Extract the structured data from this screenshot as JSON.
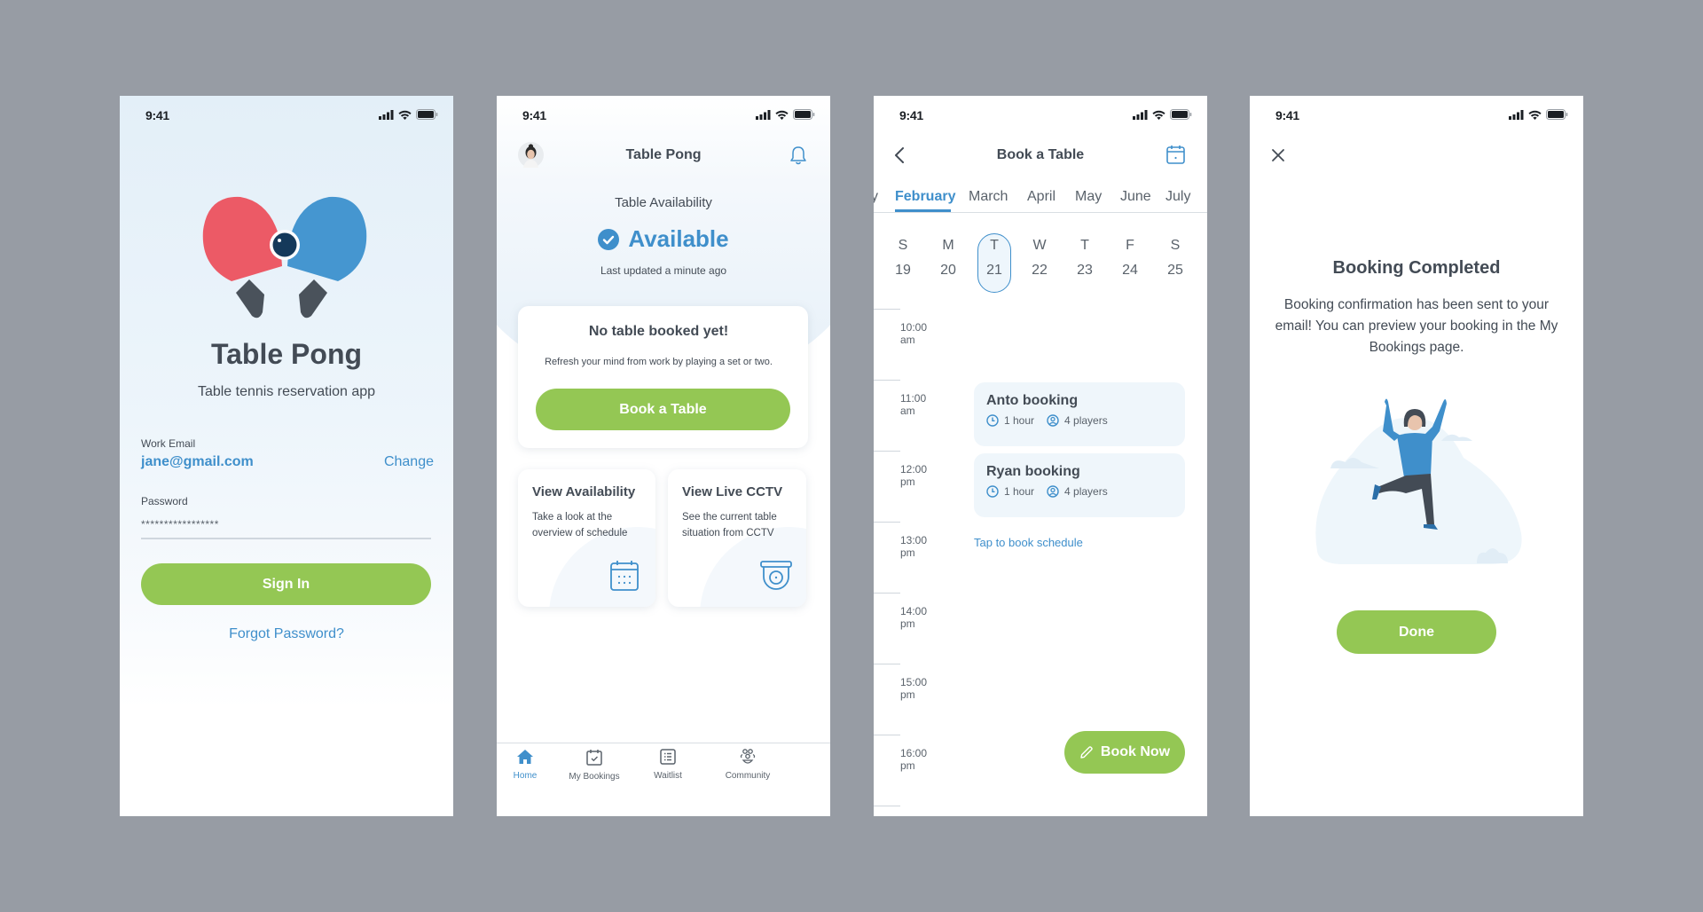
{
  "status_bar": {
    "time": "9:41"
  },
  "screens": {
    "login": {
      "app_title": "Table Pong",
      "subtitle": "Table tennis reservation app",
      "email_label": "Work Email",
      "email_value": "jane@gmail.com",
      "change_link": "Change",
      "password_label": "Password",
      "password_value": "*****************",
      "sign_in_button": "Sign In",
      "forgot_link": "Forgot Password?"
    },
    "home": {
      "header_title": "Table Pong",
      "availability_label": "Table Availability",
      "availability_status": "Available",
      "last_updated": "Last updated a minute ago",
      "empty_card": {
        "title": "No table booked yet!",
        "body": "Refresh your mind from work by playing a set or two.",
        "button": "Book a Table"
      },
      "cards": [
        {
          "title": "View Availability",
          "body_line1": "Take a look at the",
          "body_line2": "overview of schedule",
          "icon": "calendar-icon"
        },
        {
          "title": "View Live CCTV",
          "body_line1": "See the current table",
          "body_line2": "situation from CCTV",
          "icon": "cctv-camera-icon"
        }
      ],
      "nav": [
        {
          "label": "Home",
          "icon": "home-icon",
          "active": true
        },
        {
          "label": "My Bookings",
          "icon": "calendar-check-icon",
          "active": false
        },
        {
          "label": "Waitlist",
          "icon": "list-icon",
          "active": false
        },
        {
          "label": "Community",
          "icon": "community-icon",
          "active": false
        }
      ]
    },
    "book": {
      "header_title": "Book a Table",
      "months": [
        "y",
        "February",
        "March",
        "April",
        "May",
        "June",
        "July"
      ],
      "active_month": "February",
      "days": [
        {
          "dow": "S",
          "date": "19"
        },
        {
          "dow": "M",
          "date": "20"
        },
        {
          "dow": "T",
          "date": "21",
          "selected": true
        },
        {
          "dow": "W",
          "date": "22"
        },
        {
          "dow": "T",
          "date": "23"
        },
        {
          "dow": "F",
          "date": "24"
        },
        {
          "dow": "S",
          "date": "25"
        }
      ],
      "hours": [
        {
          "time": "10:00",
          "period": "am"
        },
        {
          "time": "11:00",
          "period": "am"
        },
        {
          "time": "12:00",
          "period": "pm"
        },
        {
          "time": "13:00",
          "period": "pm"
        },
        {
          "time": "14:00",
          "period": "pm"
        },
        {
          "time": "15:00",
          "period": "pm"
        },
        {
          "time": "16:00",
          "period": "pm"
        }
      ],
      "bookings": [
        {
          "title": "Anto booking",
          "duration": "1 hour",
          "players": "4 players"
        },
        {
          "title": "Ryan booking",
          "duration": "1 hour",
          "players": "4 players"
        }
      ],
      "tap_to_book": "Tap to book schedule",
      "book_now_button": "Book Now"
    },
    "completed": {
      "title": "Booking Completed",
      "body": "Booking confirmation has been sent to your email! You can preview your booking in the My Bookings page.",
      "done_button": "Done"
    }
  },
  "colors": {
    "background": "#979ca4",
    "accent_green": "#94c754",
    "accent_blue": "#3f8fcb",
    "text_dark": "#434b55",
    "paddle_red": "#ec5a66",
    "paddle_blue": "#4596d0"
  }
}
